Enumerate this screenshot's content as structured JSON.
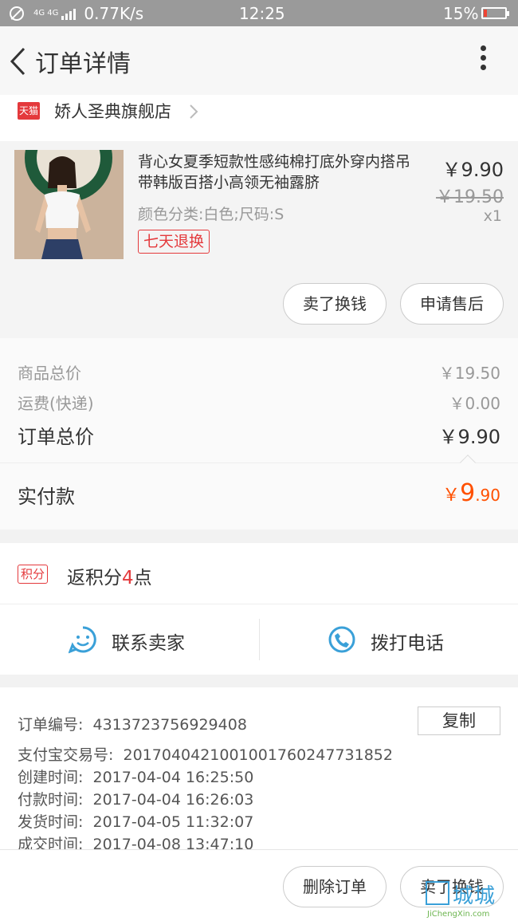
{
  "status_bar": {
    "network": "4G 4G",
    "speed": "0.77K/s",
    "time": "12:25",
    "battery": "15%",
    "battery_level": 0.15
  },
  "header": {
    "title": "订单详情"
  },
  "shop": {
    "badge": "天猫",
    "name": "娇人圣典旗舰店"
  },
  "product": {
    "title": "背心女夏季短款性感纯棉打底外穿内搭吊带韩版百搭小高领无袖露脐",
    "sku": "颜色分类:白色;尺码:S",
    "tag": "七天退换",
    "price": "￥9.90",
    "original_price": "￥19.50",
    "quantity": "x1",
    "buttons": {
      "resell": "卖了换钱",
      "aftersale": "申请售后"
    }
  },
  "totals": {
    "goods_label": "商品总价",
    "goods_value": "￥19.50",
    "shipping_label": "运费(快递)",
    "shipping_value": "￥0.00",
    "order_label": "订单总价",
    "order_value": "￥9.90",
    "paid_label": "实付款",
    "paid_yen": "￥",
    "paid_int": "9",
    "paid_dec": ".90"
  },
  "points": {
    "badge": "积分",
    "text_prefix": "返积分",
    "number": "4",
    "text_suffix": "点"
  },
  "contact": {
    "seller": "联系卖家",
    "phone": "拨打电话"
  },
  "info": {
    "copy_button": "复制",
    "rows": [
      {
        "key": "订单编号:",
        "value": "4313723756929408"
      },
      {
        "key": "支付宝交易号:",
        "value": "2017040421001001760247731852"
      },
      {
        "key": "创建时间:",
        "value": "2017-04-04 16:25:50"
      },
      {
        "key": "付款时间:",
        "value": "2017-04-04 16:26:03"
      },
      {
        "key": "发货时间:",
        "value": "2017-04-05 11:32:07"
      },
      {
        "key": "成交时间:",
        "value": "2017-04-08 13:47:10"
      }
    ]
  },
  "bottom": {
    "delete": "删除订单",
    "resell": "卖了换钱"
  },
  "watermark": {
    "cn": "城城",
    "en": "JiChengXin.com"
  },
  "colors": {
    "accent_red": "#e4393c",
    "paid_orange": "#ff5000",
    "icon_blue": "#3aa0d8"
  }
}
